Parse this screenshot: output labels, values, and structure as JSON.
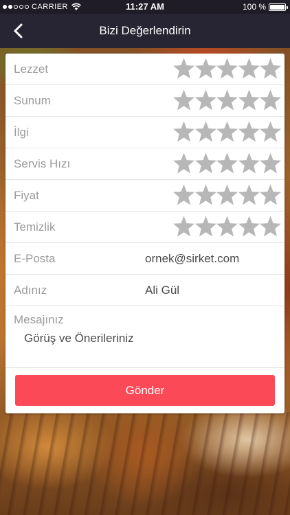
{
  "status_bar": {
    "carrier": "CARRIER",
    "time": "11:27 AM",
    "battery_percent": "100 %",
    "signal_bars_filled": 2,
    "signal_bars_total": 5,
    "battery_level": 1.0
  },
  "nav": {
    "title": "Bizi Değerlendirin",
    "back_icon": "chevron-left-icon"
  },
  "ratings": [
    {
      "label": "Lezzet",
      "stars": 0,
      "max": 5
    },
    {
      "label": "Sunum",
      "stars": 0,
      "max": 5
    },
    {
      "label": "İlgi",
      "stars": 0,
      "max": 5
    },
    {
      "label": "Servis Hızı",
      "stars": 0,
      "max": 5
    },
    {
      "label": "Fiyat",
      "stars": 0,
      "max": 5
    },
    {
      "label": "Temizlik",
      "stars": 0,
      "max": 5
    }
  ],
  "form": {
    "email_label": "E-Posta",
    "email_placeholder": "ornek@sirket.com",
    "email_value": "",
    "name_label": "Adınız",
    "name_placeholder": "Ali Gül",
    "name_value": "",
    "message_label": "Mesajınız",
    "message_placeholder": "Görüş ve Önerileriniz",
    "submit_label": "Gönder"
  },
  "colors": {
    "star_empty": "#b7b7b7",
    "submit_button": "#fc4957",
    "nav_bar": "#272433"
  }
}
